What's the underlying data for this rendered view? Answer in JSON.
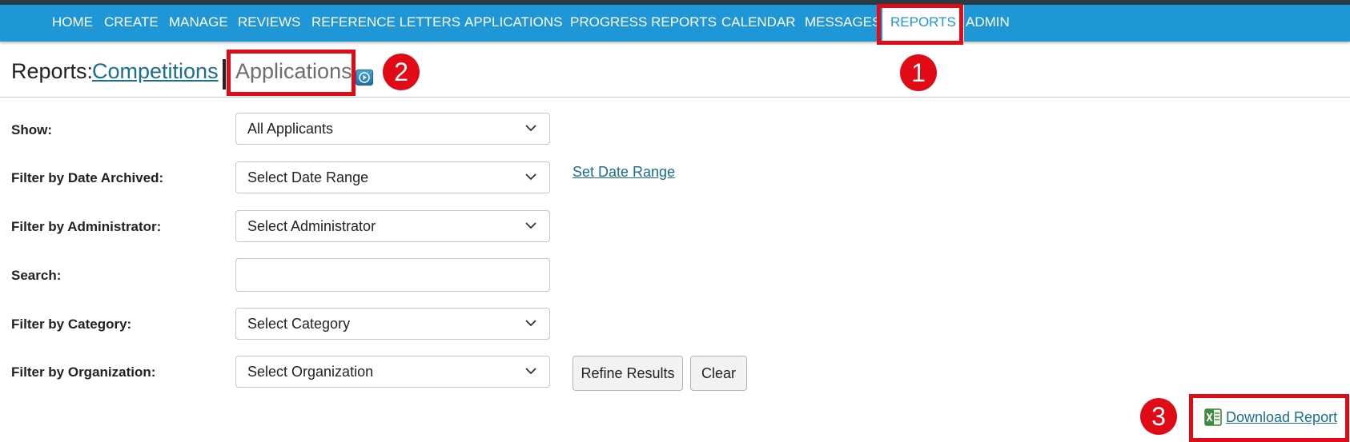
{
  "nav": {
    "items": [
      {
        "label": "HOME"
      },
      {
        "label": "CREATE"
      },
      {
        "label": "MANAGE"
      },
      {
        "label": "REVIEWS"
      },
      {
        "label": "REFERENCE LETTERS"
      },
      {
        "label": "APPLICATIONS"
      },
      {
        "label": "PROGRESS REPORTS"
      },
      {
        "label": "CALENDAR"
      },
      {
        "label": "MESSAGES"
      },
      {
        "label": "REPORTS",
        "active": true
      },
      {
        "label": "ADMIN"
      }
    ]
  },
  "header": {
    "label": "Reports:",
    "competitions_link": "Competitions",
    "applications_label": "Applications"
  },
  "form": {
    "show": {
      "label": "Show:",
      "value": "All Applicants"
    },
    "date_archived": {
      "label": "Filter by Date Archived:",
      "value": "Select Date Range",
      "link": "Set Date Range"
    },
    "administrator": {
      "label": "Filter by Administrator:",
      "value": "Select Administrator"
    },
    "search": {
      "label": "Search:",
      "value": ""
    },
    "category": {
      "label": "Filter by Category:",
      "value": "Select Category"
    },
    "organization": {
      "label": "Filter by Organization:",
      "value": "Select Organization"
    },
    "refine_button": "Refine Results",
    "clear_button": "Clear"
  },
  "download": {
    "label": "Download Report",
    "icon": "excel-icon"
  },
  "callouts": [
    "1",
    "2",
    "3"
  ],
  "colors": {
    "navbar": "#1f97d6",
    "callout": "#e00b17",
    "link": "#1a6f8c"
  }
}
